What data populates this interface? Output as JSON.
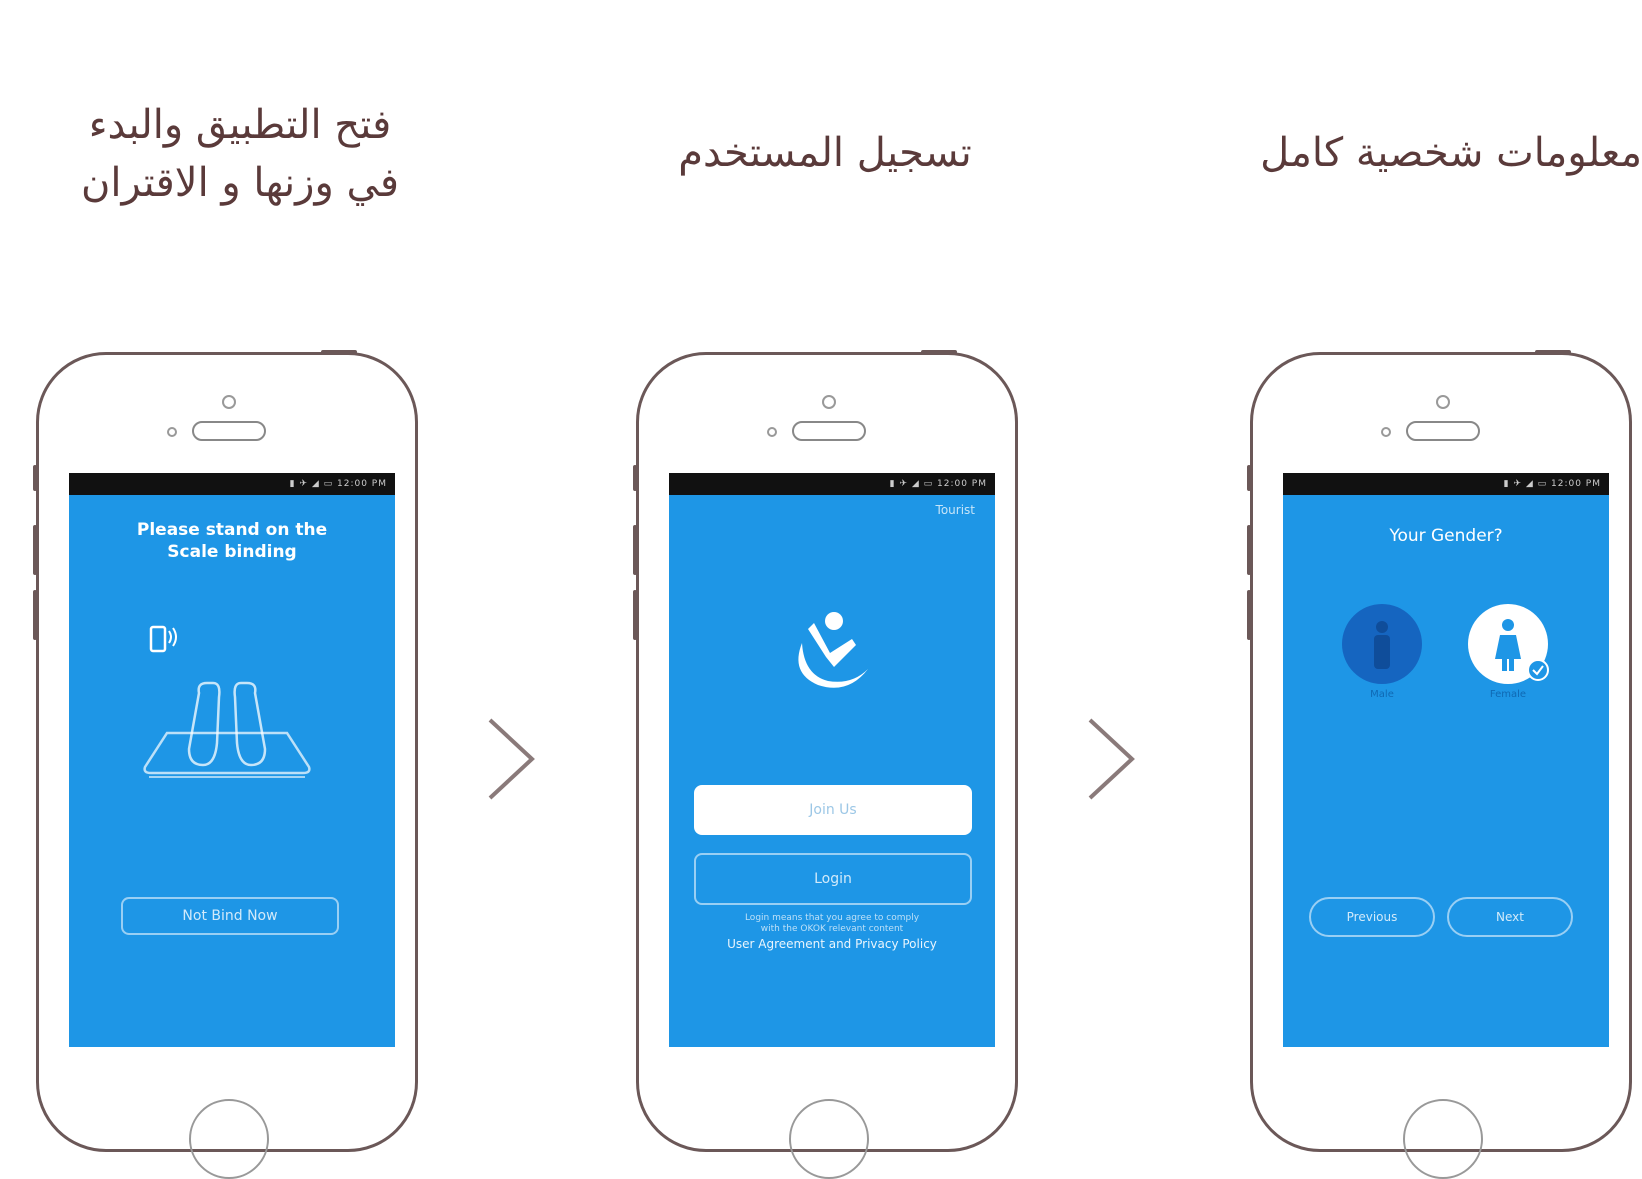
{
  "captions": {
    "step1": {
      "line1": "فتح التطبيق والبدء",
      "line2": "في وزنها و الاقتران"
    },
    "step2": {
      "line1": "تسجيل المستخدم"
    },
    "step3": {
      "line1": "معلومات شخصية كامل"
    }
  },
  "phone1": {
    "status": "▮ ✈ ◢ ▭ 12:00 PM",
    "title_line1": "Please stand on the",
    "title_line2": "Scale binding",
    "not_bind_button": "Not Bind Now"
  },
  "phone2": {
    "status": "▮ ✈ ◢ ▭ 12:00 PM",
    "tourist_link": "Tourist",
    "join_button": "Join Us",
    "login_button": "Login",
    "legal_line1": "Login means that you agree to comply",
    "legal_line2": "with the OKOK relevant content",
    "legal_link": "User Agreement and Privacy Policy"
  },
  "phone3": {
    "status": "▮ ✈ ◢ ▭ 12:00 PM",
    "title": "Your Gender?",
    "male_label": "Male",
    "female_label": "Female",
    "previous_button": "Previous",
    "next_button": "Next"
  },
  "colors": {
    "screen_blue": "#1e96e6",
    "caption": "#5a3a3a",
    "frame": "#6b5858"
  },
  "icons": [
    "phone-signal-icon",
    "scale-feet-icon",
    "app-logo-icon",
    "male-icon",
    "female-icon",
    "check-icon",
    "chevron-right-icon"
  ]
}
